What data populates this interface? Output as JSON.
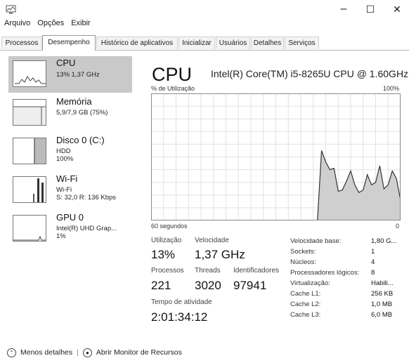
{
  "window": {
    "minimize_glyph": "–",
    "maximize_glyph": "☐",
    "close_glyph": "✕"
  },
  "menu": [
    "Arquivo",
    "Opções",
    "Exibir"
  ],
  "tabs": [
    "Processos",
    "Desempenho",
    "Histórico de aplicativos",
    "Inicializar",
    "Usuários",
    "Detalhes",
    "Serviços"
  ],
  "active_tab": "Desempenho",
  "sidebar": [
    {
      "title": "CPU",
      "lines": [
        "13% 1,37 GHz"
      ]
    },
    {
      "title": "Memória",
      "lines": [
        "5,9/7,9 GB (75%)"
      ]
    },
    {
      "title": "Disco 0 (C:)",
      "lines": [
        "HDD",
        "100%"
      ]
    },
    {
      "title": "Wi-Fi",
      "lines": [
        "Wi-Fi",
        "S: 32,0 R: 136 Kbps"
      ]
    },
    {
      "title": "GPU 0",
      "lines": [
        "Intel(R) UHD Grap...",
        "1%"
      ]
    }
  ],
  "main": {
    "title": "CPU",
    "model": "Intel(R) Core(TM) i5-8265U CPU @ 1.60GHz",
    "graph_label": "% de Utilização",
    "graph_max": "100%",
    "time_span": "60 segundos",
    "time_end": "0"
  },
  "chart_data": {
    "type": "area",
    "y_range": [
      0,
      100
    ],
    "grid": true,
    "values": [
      0,
      0,
      0,
      0,
      0,
      0,
      0,
      0,
      0,
      0,
      0,
      0,
      0,
      0,
      0,
      0,
      0,
      0,
      0,
      0,
      0,
      0,
      0,
      0,
      0,
      0,
      0,
      0,
      0,
      0,
      0,
      0,
      0,
      0,
      0,
      0,
      0,
      0,
      0,
      0,
      0,
      55,
      46,
      40,
      41,
      23,
      24,
      31,
      39,
      28,
      22,
      24,
      36,
      28,
      30,
      43,
      25,
      28,
      39,
      33,
      16
    ]
  },
  "stats": {
    "utilizacao_label": "Utilização",
    "utilizacao": "13%",
    "velocidade_label": "Velocidade",
    "velocidade": "1,37 GHz",
    "processos_label": "Processos",
    "processos": "221",
    "threads_label": "Threads",
    "threads": "3020",
    "identificadores_label": "Identificadores",
    "identificadores": "97941",
    "tempo_label": "Tempo de atividade",
    "tempo": "2:01:34:12"
  },
  "specs": [
    {
      "label": "Velocidade base:",
      "value": "1,80 G..."
    },
    {
      "label": "Sockets:",
      "value": "1"
    },
    {
      "label": "Núcleos:",
      "value": "4"
    },
    {
      "label": "Processadores lógicos:",
      "value": "8"
    },
    {
      "label": "Virtualização:",
      "value": "Habili..."
    },
    {
      "label": "Cache L1:",
      "value": "256 KB"
    },
    {
      "label": "Cache L2:",
      "value": "1,0 MB"
    },
    {
      "label": "Cache L3:",
      "value": "6,0 MB"
    }
  ],
  "footer": {
    "less_details": "Menos detalhes",
    "separator": "|",
    "resource_monitor": "Abrir Monitor de Recursos"
  },
  "icons": {
    "app": "task-manager-icon",
    "less_details": "chevron-up-icon",
    "resource_monitor": "resource-monitor-icon"
  }
}
